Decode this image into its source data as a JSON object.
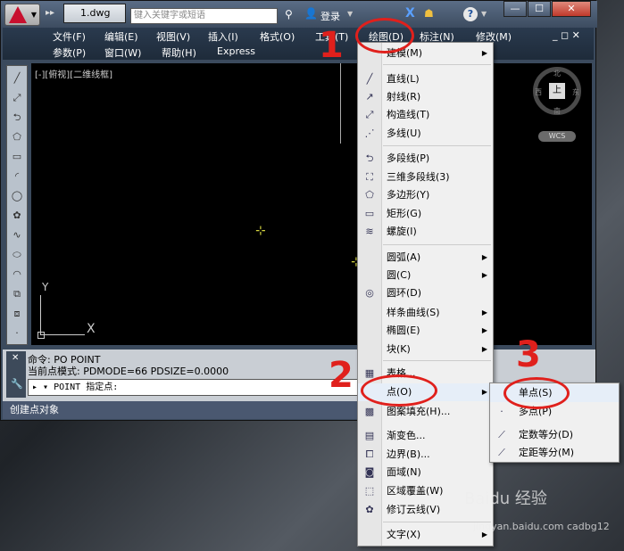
{
  "window": {
    "doc_tab": "1.dwg",
    "search_placeholder": "键入关键字或短语",
    "login": "登录",
    "help": "?"
  },
  "menubar": {
    "row1": [
      "文件(F)",
      "编辑(E)",
      "视图(V)",
      "插入(I)",
      "格式(O)",
      "工具(T)",
      "绘图(D)",
      "标注(N)",
      "修改(M)"
    ],
    "row2": [
      "参数(P)",
      "窗口(W)",
      "帮助(H)",
      "Express"
    ]
  },
  "canvas": {
    "view_label": "[-][俯视][二维线框]",
    "ucs_y": "Y",
    "ucs_x": "X",
    "navcube_top": "上",
    "dir_n": "北",
    "dir_s": "南",
    "dir_e": "东",
    "dir_w": "西",
    "wcs": "WCS"
  },
  "command": {
    "line1": "命令: PO POINT",
    "line2": "当前点模式:  PDMODE=66  PDSIZE=0.0000",
    "input": "▸ ▾ POINT 指定点:"
  },
  "status": {
    "text": "创建点对象"
  },
  "draw_menu": {
    "items": [
      {
        "label": "建模(M)",
        "submenu": true
      },
      {
        "label": "直线(L)"
      },
      {
        "label": "射线(R)"
      },
      {
        "label": "构造线(T)"
      },
      {
        "label": "多线(U)"
      },
      {
        "label": "多段线(P)"
      },
      {
        "label": "三维多段线(3)"
      },
      {
        "label": "多边形(Y)"
      },
      {
        "label": "矩形(G)"
      },
      {
        "label": "螺旋(I)"
      },
      {
        "label": "圆弧(A)",
        "submenu": true
      },
      {
        "label": "圆(C)",
        "submenu": true
      },
      {
        "label": "圆环(D)"
      },
      {
        "label": "样条曲线(S)",
        "submenu": true
      },
      {
        "label": "椭圆(E)",
        "submenu": true
      },
      {
        "label": "块(K)",
        "submenu": true
      },
      {
        "label": "表格..."
      },
      {
        "label": "点(O)",
        "submenu": true
      },
      {
        "label": "图案填充(H)..."
      },
      {
        "label": "渐变色..."
      },
      {
        "label": "边界(B)..."
      },
      {
        "label": "面域(N)"
      },
      {
        "label": "区域覆盖(W)"
      },
      {
        "label": "修订云线(V)"
      },
      {
        "label": "文字(X)",
        "submenu": true
      }
    ]
  },
  "point_menu": {
    "items": [
      {
        "label": "单点(S)"
      },
      {
        "label": "多点(P)"
      },
      {
        "label": "定数等分(D)"
      },
      {
        "label": "定距等分(M)"
      }
    ]
  },
  "annotations": {
    "a1": "1",
    "a2": "2",
    "a3": "3"
  },
  "watermark": {
    "line1": "Baidu 经验",
    "line2": "jingyan.baidu.com  cadbg12"
  },
  "colors": {
    "annotation": "#e0201c",
    "canvas": "#000000",
    "point_marker": "#d6d640"
  }
}
